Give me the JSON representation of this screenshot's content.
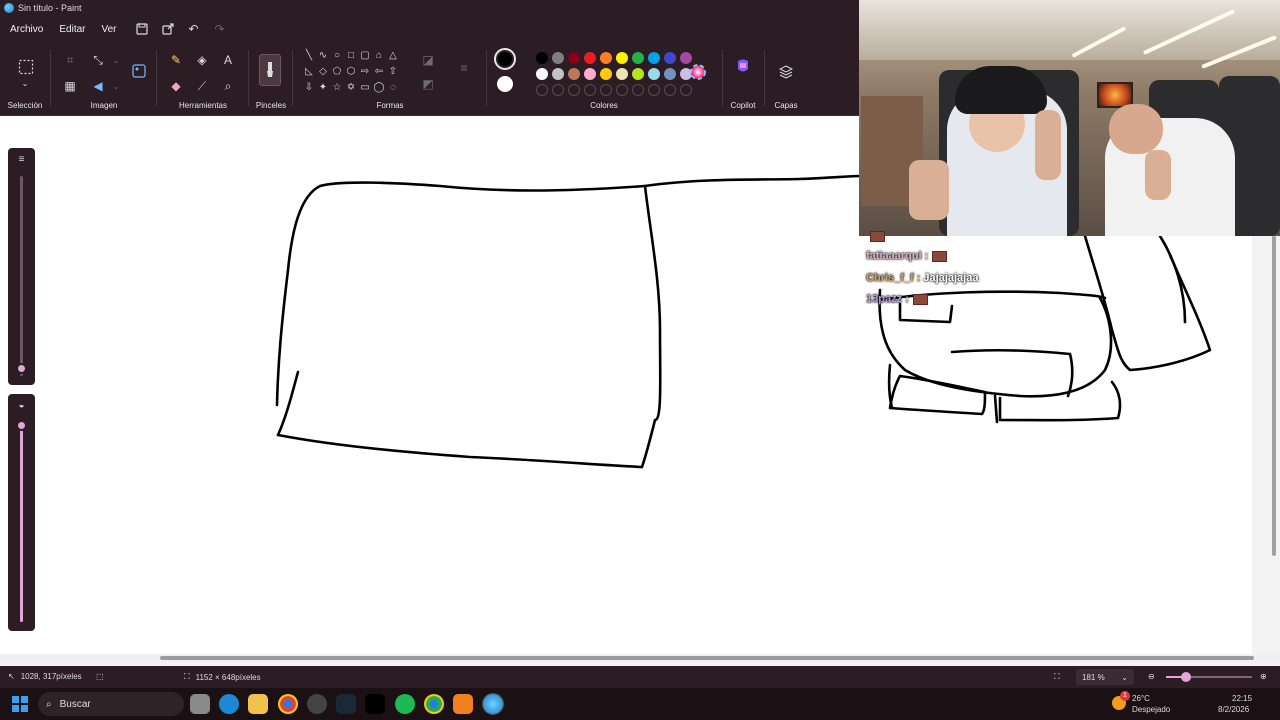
{
  "window": {
    "title": "Sin título - Paint"
  },
  "menu": {
    "items": [
      "Archivo",
      "Editar",
      "Ver"
    ]
  },
  "ribbon": {
    "groups": {
      "seleccion": "Selección",
      "imagen": "Imagen",
      "herramientas": "Herramientas",
      "pinceles": "Pinceles",
      "formas": "Formas",
      "colores": "Colores",
      "copilot": "Copilot",
      "capas": "Capas"
    },
    "palette_row1": [
      "#000000",
      "#7f7f7f",
      "#880015",
      "#ed1c24",
      "#ff7f27",
      "#fff200",
      "#22b14c",
      "#00a2e8",
      "#3f48cc",
      "#a349a4"
    ],
    "palette_row2": [
      "#ffffff",
      "#c3c3c3",
      "#b97a57",
      "#ffaec9",
      "#ffc90e",
      "#efe4b0",
      "#b5e61d",
      "#99d9ea",
      "#7092be",
      "#c8bfe7"
    ],
    "color1": "#000000",
    "color2": "#ffffff"
  },
  "chat": [
    {
      "name": "",
      "message": "",
      "color": "#c7b3d9"
    },
    {
      "name": "fatiaaarqui :",
      "message": "",
      "color": "#d9b3c8"
    },
    {
      "name": "Chris_f_f :",
      "message": "Jajajajajaa",
      "color": "#d4a35a"
    },
    {
      "name": "13pazz :",
      "message": "",
      "color": "#b59ad6"
    }
  ],
  "status": {
    "cursor": "1028, 317píxeles",
    "canvas_size": "1152 × 648píxeles",
    "zoom": "181 %"
  },
  "taskbar": {
    "search": "Buscar",
    "weather_temp": "26°C",
    "weather_desc": "Despejado",
    "time": "22:15",
    "date": "8/2/2026",
    "notification_count": "1"
  }
}
